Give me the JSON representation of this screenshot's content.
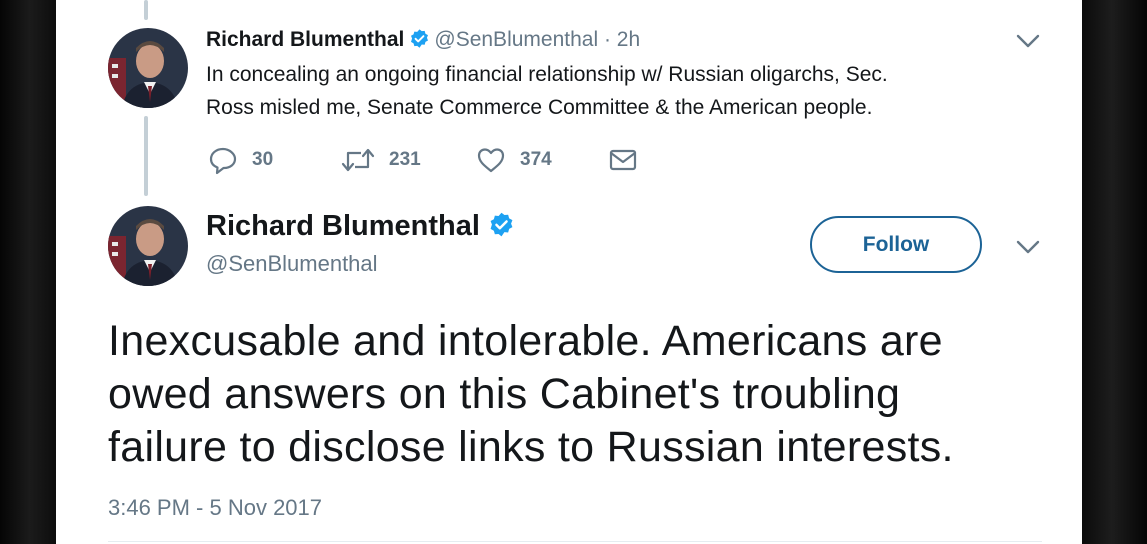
{
  "previous_tweet": {
    "author_name": "Richard Blumenthal",
    "handle": "@SenBlumenthal",
    "time": "· 2h",
    "text_lines": [
      "In concealing an ongoing financial relationship w/ Russian oligarchs, Sec.",
      "Ross misled me, Senate Commerce Committee & the American people."
    ],
    "actions": {
      "replies": "30",
      "retweets": "231",
      "likes": "374"
    }
  },
  "main_tweet": {
    "author_name": "Richard Blumenthal",
    "handle": "@SenBlumenthal",
    "follow_label": "Follow",
    "text_lines": [
      "Inexcusable and intolerable. Americans are",
      "owed answers on this Cabinet's troubling",
      "failure to disclose links to Russian interests."
    ],
    "timestamp": "3:46 PM - 5 Nov 2017"
  },
  "icons": [
    "verified-badge-icon",
    "reply-icon",
    "retweet-icon",
    "like-icon",
    "direct-message-icon",
    "chevron-down-icon",
    "avatar"
  ],
  "colors": {
    "verified_blue": "#1da1f2",
    "follow_border": "#1c6396",
    "muted_text": "#657786",
    "text": "#14171a",
    "thread_line": "#c4cfd6"
  }
}
